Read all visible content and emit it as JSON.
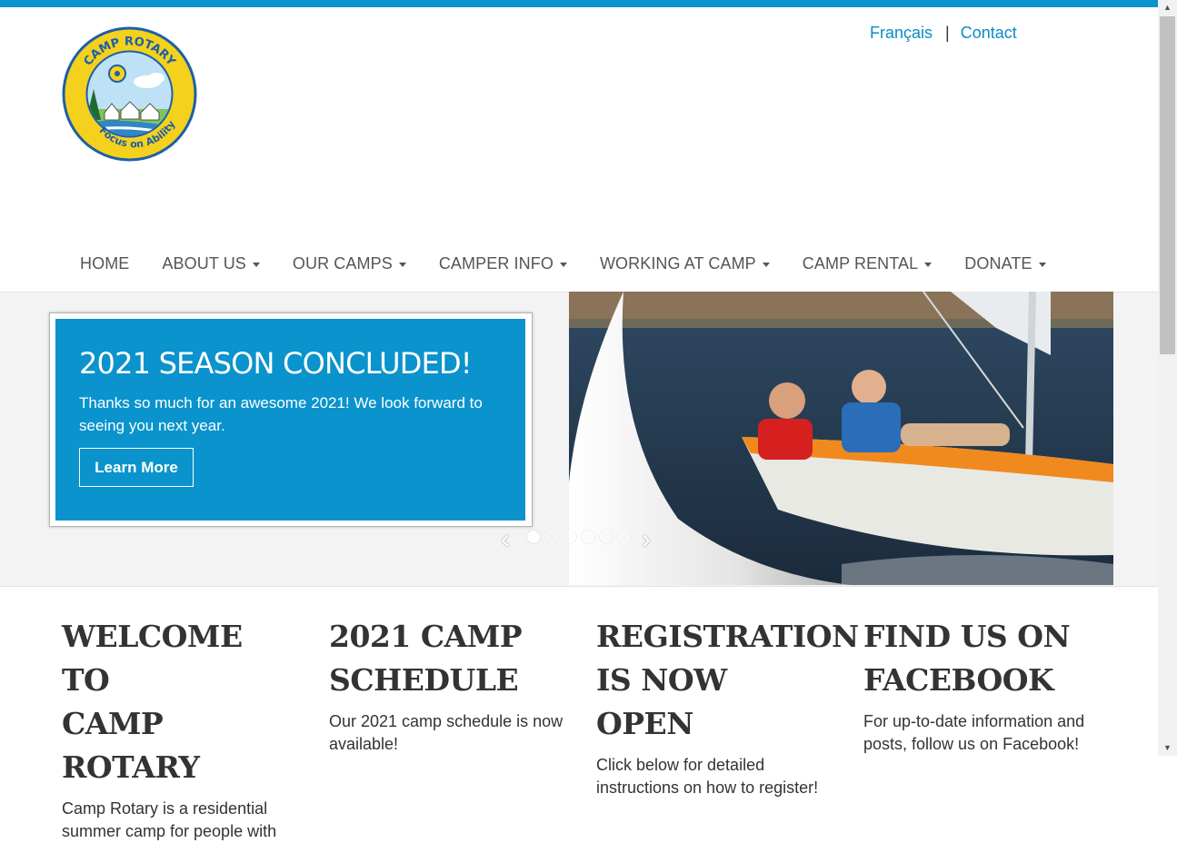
{
  "logo": {
    "ring_text_top": "CAMP ROTARY",
    "ring_text_bottom": "Focus on Ability"
  },
  "top_links": {
    "french": "Français",
    "separator": "|",
    "contact": "Contact"
  },
  "nav": {
    "items": [
      {
        "label": "HOME",
        "dropdown": false
      },
      {
        "label": "ABOUT US",
        "dropdown": true
      },
      {
        "label": "OUR CAMPS",
        "dropdown": true
      },
      {
        "label": "CAMPER INFO",
        "dropdown": true
      },
      {
        "label": "WORKING AT CAMP",
        "dropdown": true
      },
      {
        "label": "CAMP RENTAL",
        "dropdown": true
      },
      {
        "label": "DONATE",
        "dropdown": true
      }
    ]
  },
  "slider": {
    "heading": "2021 SEASON CONCLUDED!",
    "text": "Thanks so much for an awesome 2021! We look forward to seeing you next year.",
    "button": "Learn More",
    "slide_count": 6,
    "active_slide": 1,
    "prev_icon": "chevron-left-icon",
    "next_icon": "chevron-right-icon"
  },
  "columns": [
    {
      "title_line1": "WELCOME TO",
      "title_line2": "CAMP ROTARY",
      "text_line1": "Camp Rotary is a residential",
      "text_line2": "summer camp for people with"
    },
    {
      "title_line1": "2021 CAMP",
      "title_line2": "SCHEDULE",
      "text_line1": "Our 2021 camp schedule is now",
      "text_line2": "available!"
    },
    {
      "title_line1": "REGISTRATION",
      "title_line2": "IS NOW OPEN",
      "text_line1": "Click below for detailed",
      "text_line2": "instructions on how to register!"
    },
    {
      "title_line1": "FIND US ON",
      "title_line2": "FACEBOOK",
      "text_line1": "For up-to-date information and",
      "text_line2": "posts, follow us on Facebook!"
    }
  ],
  "colors": {
    "accent": "#0a93cc",
    "logo_yellow": "#f4d11c",
    "logo_blue": "#1d5fa8"
  }
}
